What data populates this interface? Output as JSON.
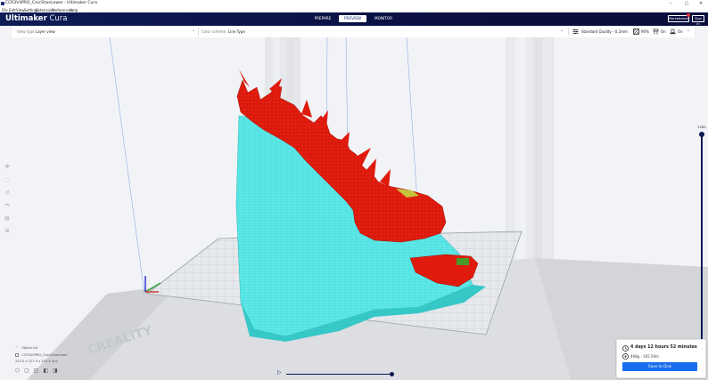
{
  "window": {
    "title": "CCR3V4PRO_CrocShoeLower - Ultimaker Cura",
    "controls": [
      "–",
      "▢",
      "✕"
    ]
  },
  "menu": [
    "File",
    "Edit",
    "View",
    "Settings",
    "Extensions",
    "Preferences",
    "Help"
  ],
  "header": {
    "logo_brand": "Ultimaker",
    "logo_product": "Cura",
    "stages": [
      "PREPARE",
      "PREVIEW",
      "MONITOR"
    ],
    "active_stage": "PREVIEW",
    "marketplace_label": "Marketplace",
    "signin_label": "Sign in"
  },
  "viewbar": {
    "view_type_label": "View type",
    "view_type_value": "Layer view",
    "color_scheme_label": "Color scheme",
    "color_scheme_value": "Line Type",
    "profile": "Standard Quality - 0.2mm",
    "infill": "90%",
    "support": "On",
    "adhesion": "On"
  },
  "layer_slider": {
    "top_layer": "1262"
  },
  "object_list": {
    "header": "Object list",
    "object_name": "CCR3V4PRO_CrocShoeLower",
    "dimensions": "222.0 x 227.9 x 253.4 mm"
  },
  "job": {
    "time": "4 days 12 hours 52 minutes",
    "material": "498g · 165.59m",
    "save_label": "Save to Disk"
  },
  "colors": {
    "header_bg": "#0a0f3e",
    "accent": "#196ef0",
    "model_red": "#e01b0d",
    "support_cyan": "#5ae6e6"
  }
}
